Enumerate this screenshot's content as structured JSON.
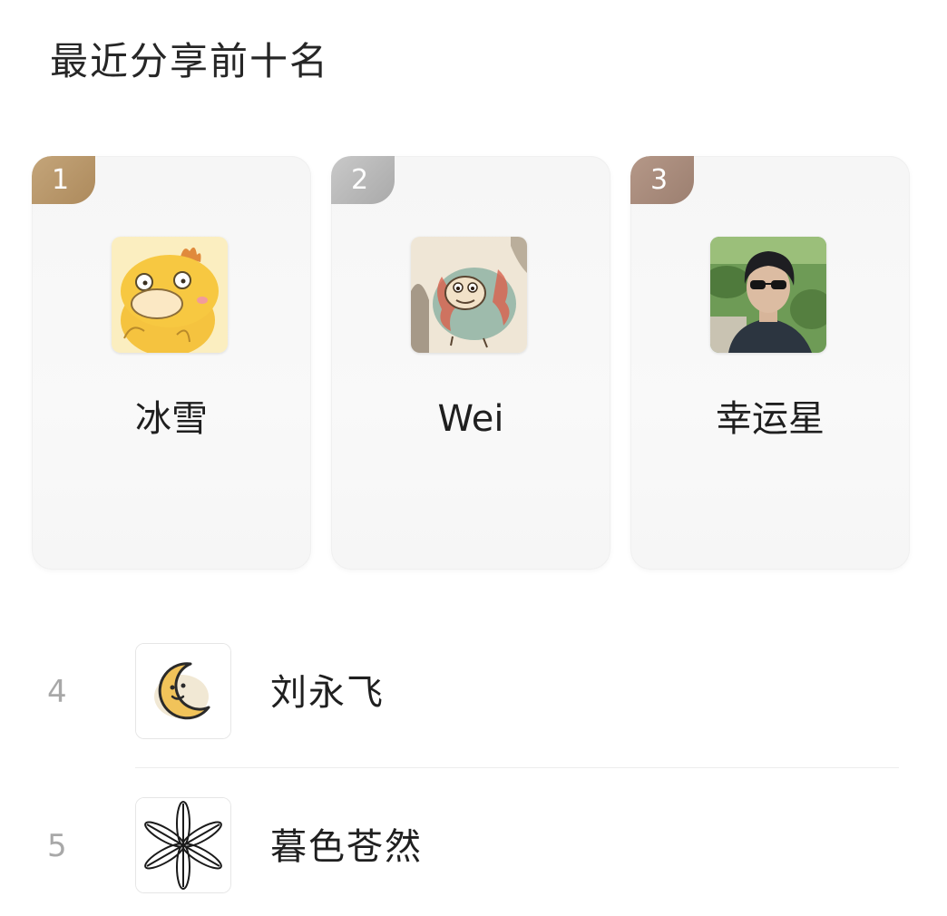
{
  "section_title": "最近分享前十名",
  "top_three": [
    {
      "rank": "1",
      "name": "冰雪",
      "avatar_icon": "psyduck-avatar-icon",
      "badge_color": "#b8976b"
    },
    {
      "rank": "2",
      "name": "Wei",
      "avatar_icon": "dragon-painting-avatar-icon",
      "badge_color": "#b5b5b5"
    },
    {
      "rank": "3",
      "name": "幸运星",
      "avatar_icon": "person-photo-avatar-icon",
      "badge_color": "#a88c7e"
    }
  ],
  "list": [
    {
      "rank": "4",
      "name": "刘永飞",
      "avatar_icon": "crescent-moon-avatar-icon"
    },
    {
      "rank": "5",
      "name": "暮色苍然",
      "avatar_icon": "flower-line-avatar-icon"
    }
  ],
  "colors": {
    "gold": "#b8976b",
    "silver": "#b5b5b5",
    "bronze": "#a88c7e",
    "rank_text": "#a8a8a8"
  }
}
